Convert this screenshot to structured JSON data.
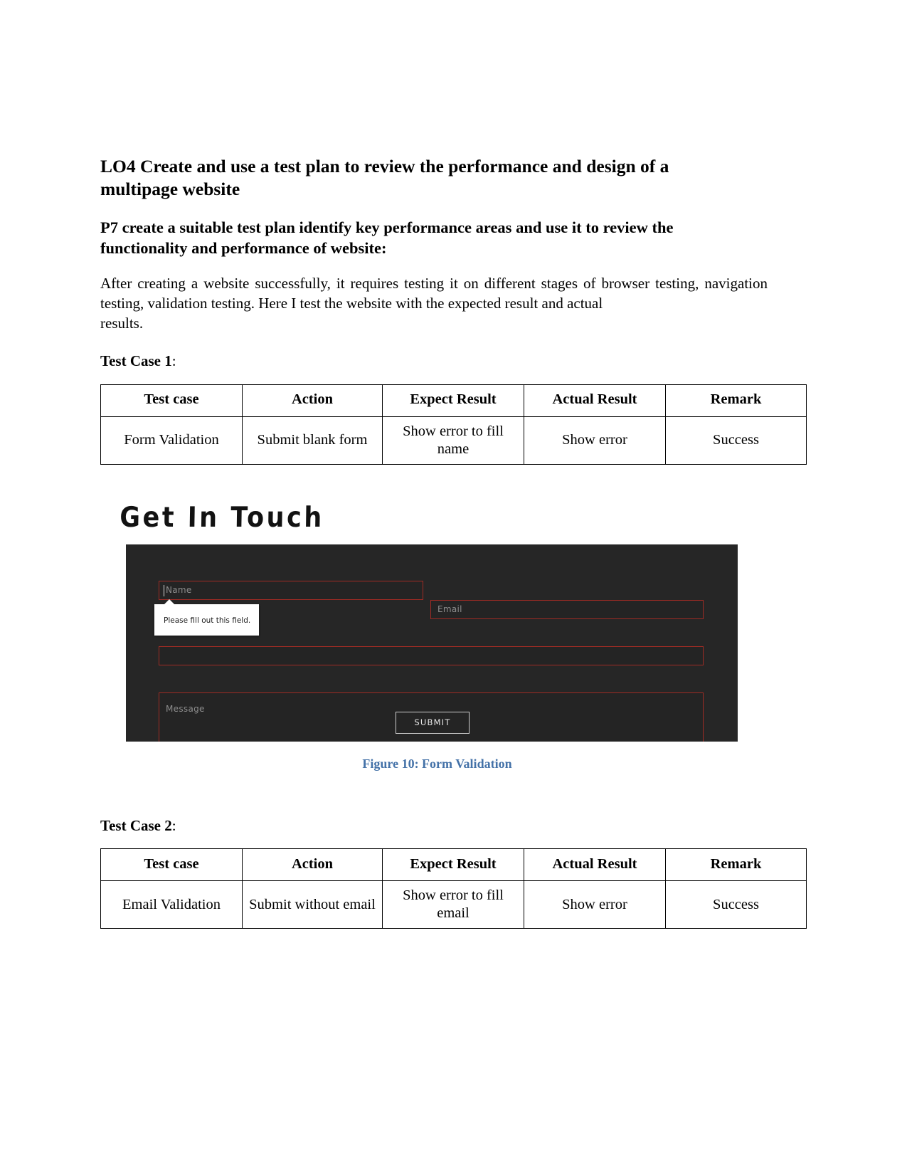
{
  "document": {
    "lo_heading": "LO4 Create and use a test plan to review the performance and design of a",
    "lo_heading_line2": "multipage website",
    "p7_heading": "P7 create a suitable test plan identify key performance areas and use it to review the",
    "p7_heading_line2": "functionality and performance of website:",
    "intro_paragraph": "After creating a website successfully, it requires testing it on different stages of browser testing, navigation testing, validation testing. Here I test the website with the expected result and actual",
    "intro_paragraph_line3": "results."
  },
  "test_case_1": {
    "label_bold": "Test Case 1",
    "label_suffix": ":",
    "table": {
      "headers": [
        "Test case",
        "Action",
        "Expect Result",
        "Actual Result",
        "Remark"
      ],
      "rows": [
        [
          "Form Validation",
          "Submit blank form",
          "Show error to fill name",
          "Show error",
          "Success"
        ]
      ]
    }
  },
  "test_case_2": {
    "label_bold": "Test Case 2",
    "label_suffix": ":",
    "table": {
      "headers": [
        "Test case",
        "Action",
        "Expect Result",
        "Actual Result",
        "Remark"
      ],
      "rows": [
        [
          "Email Validation",
          "Submit without email",
          "Show error to fill email",
          "Show error",
          "Success"
        ]
      ]
    }
  },
  "figure": {
    "caption": "Figure 10: Form Validation",
    "caption_color": "#4472a8",
    "screenshot": {
      "heading": "Get In Touch",
      "panel_background": "#262626",
      "field_border_color": "#a02b24",
      "placeholder_color": "#8d8d8d",
      "fields": [
        {
          "name": "name-field",
          "placeholder": "Name",
          "value": ""
        },
        {
          "name": "email-field",
          "placeholder": "Email",
          "value": ""
        },
        {
          "name": "subject-field",
          "placeholder": "",
          "value": ""
        },
        {
          "name": "message-field",
          "placeholder": "Message",
          "value": ""
        }
      ],
      "validation_tooltip": "Please fill out this field.",
      "submit_label": "SUBMIT"
    }
  }
}
